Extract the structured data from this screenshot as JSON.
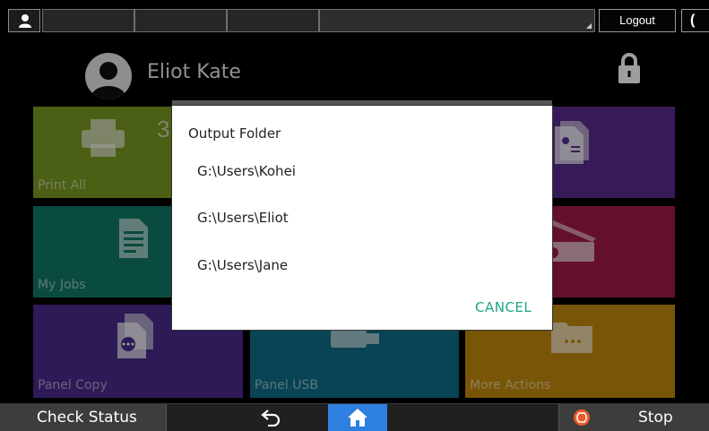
{
  "topbar": {
    "logout_label": "Logout",
    "user_icon": "user-icon",
    "moon_icon": "moon-icon",
    "moon_glyph": "("
  },
  "header": {
    "username": "Eliot Kate",
    "lock_icon": "lock-icon"
  },
  "tiles": [
    {
      "label": "Print All",
      "icon": "printer-icon",
      "count": "3",
      "color": "#7a9a23"
    },
    {
      "label": "My Jobs",
      "icon": "document-icon",
      "color": "#117a68"
    },
    {
      "label": "Panel Copy",
      "icon": "copy-icon",
      "color": "#4a2b8c"
    },
    {
      "label": "Panel USB",
      "icon": "usb-icon",
      "color": "#0e6f86"
    },
    {
      "label": "More Actions",
      "icon": "folder-icon",
      "color": "#c48a0e"
    },
    {
      "label": "",
      "icon": "scan-icon",
      "color": "#5a2d8e"
    },
    {
      "label": "",
      "icon": "scanner-icon",
      "color": "#a41a44"
    }
  ],
  "dialog": {
    "title": "Output Folder",
    "options": [
      "G:\\Users\\Kohei",
      "G:\\Users\\Eliot",
      "G:\\Users\\Jane"
    ],
    "cancel_label": "CANCEL",
    "accent_color": "#1aa589"
  },
  "bottombar": {
    "check_status_label": "Check Status",
    "back_icon": "back-arrow-icon",
    "home_icon": "home-icon",
    "stop_icon": "stop-icon",
    "stop_label": "Stop",
    "home_color": "#2d80e0"
  }
}
